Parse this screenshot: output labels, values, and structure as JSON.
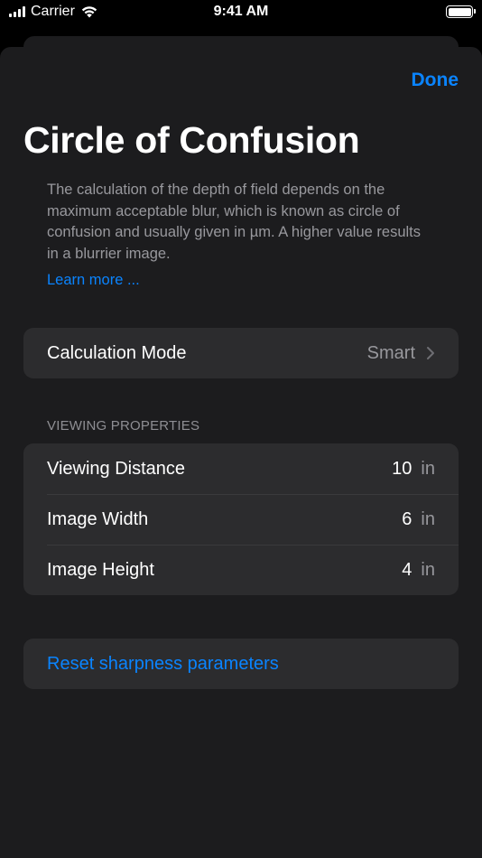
{
  "status_bar": {
    "carrier": "Carrier",
    "time": "9:41 AM"
  },
  "sheet": {
    "done_label": "Done",
    "title": "Circle of Confusion",
    "description": "The calculation of the depth of field depends on the maximum acceptable blur, which is known as circle of confusion and usually given in µm. A higher value results in a blurrier image.",
    "learn_more": "Learn more ..."
  },
  "calculation_mode": {
    "label": "Calculation Mode",
    "value": "Smart"
  },
  "viewing_properties": {
    "header": "VIEWING PROPERTIES",
    "rows": [
      {
        "label": "Viewing Distance",
        "value": "10",
        "unit": "in"
      },
      {
        "label": "Image Width",
        "value": "6",
        "unit": "in"
      },
      {
        "label": "Image Height",
        "value": "4",
        "unit": "in"
      }
    ]
  },
  "reset": {
    "label": "Reset sharpness parameters"
  },
  "colors": {
    "accent": "#0a84ff",
    "sheet_background": "#1c1c1e",
    "cell_background": "#2c2c2e",
    "secondary_text": "#98989d"
  }
}
